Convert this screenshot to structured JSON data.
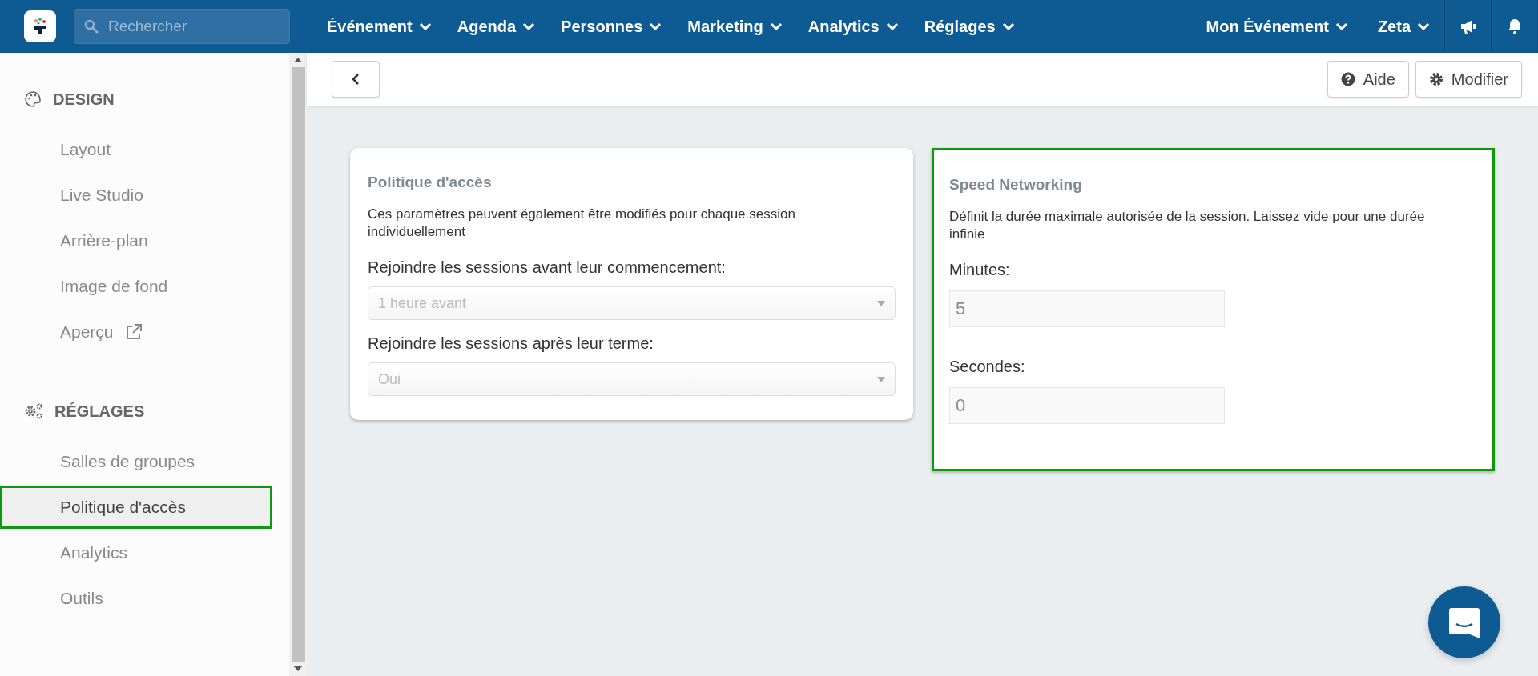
{
  "topbar": {
    "search": {
      "placeholder": "Rechercher"
    },
    "menus": [
      {
        "label": "Événement"
      },
      {
        "label": "Agenda"
      },
      {
        "label": "Personnes"
      },
      {
        "label": "Marketing"
      },
      {
        "label": "Analytics"
      },
      {
        "label": "Réglages"
      }
    ],
    "right_menus": [
      {
        "label": "Mon Événement"
      },
      {
        "label": "Zeta"
      }
    ]
  },
  "sidebar": {
    "sections": [
      {
        "title": "DESIGN",
        "kind": "design",
        "items": [
          {
            "label": "Layout",
            "selected": false,
            "highlighted": false,
            "external": false
          },
          {
            "label": "Live Studio",
            "selected": false,
            "highlighted": false,
            "external": false
          },
          {
            "label": "Arrière-plan",
            "selected": false,
            "highlighted": false,
            "external": false
          },
          {
            "label": "Image de fond",
            "selected": false,
            "highlighted": false,
            "external": false
          },
          {
            "label": "Aperçu",
            "selected": false,
            "highlighted": false,
            "external": true
          }
        ]
      },
      {
        "title": "RÉGLAGES",
        "kind": "settings",
        "items": [
          {
            "label": "Salles de groupes",
            "selected": false,
            "highlighted": false,
            "external": false
          },
          {
            "label": "Politique d'accès",
            "selected": true,
            "highlighted": true,
            "external": false
          },
          {
            "label": "Analytics",
            "selected": false,
            "highlighted": false,
            "external": false
          },
          {
            "label": "Outils",
            "selected": false,
            "highlighted": false,
            "external": false
          }
        ]
      }
    ]
  },
  "toolbar": {
    "buttons": [
      {
        "label": "Aide",
        "kind": "help"
      },
      {
        "label": "Modifier",
        "kind": "settings"
      }
    ]
  },
  "cards": [
    {
      "title": "Politique d'accès",
      "description": "Ces paramètres peuvent également être modifiés pour chaque session individuellement",
      "highlighted": false,
      "fields": [
        {
          "kind": "select",
          "label": "Rejoindre les sessions avant leur commencement:",
          "value": "1 heure avant"
        },
        {
          "kind": "select",
          "label": "Rejoindre les sessions après leur terme:",
          "value": "Oui"
        }
      ]
    },
    {
      "title": "Speed Networking",
      "description": "Définit la durée maximale autorisée de la session. Laissez vide pour une durée infinie",
      "highlighted": true,
      "fields": [
        {
          "kind": "input",
          "label": "Minutes:",
          "value": "5"
        },
        {
          "kind": "input",
          "label": "Secondes:",
          "value": "0"
        }
      ]
    }
  ]
}
